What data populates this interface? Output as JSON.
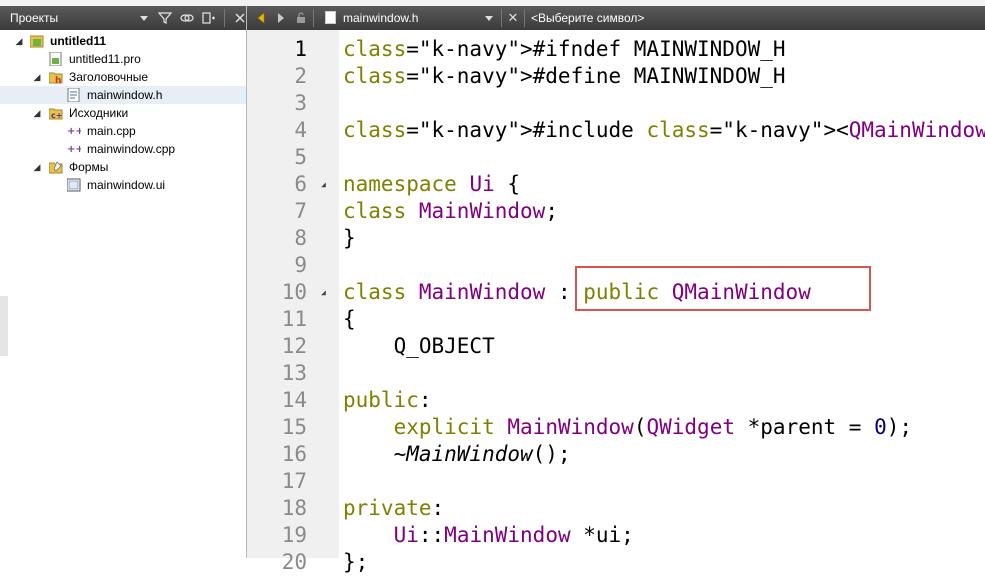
{
  "left_panel": {
    "selector_label": "Проекты",
    "toolbar_icons": [
      "filter-icon",
      "link-icon",
      "split-icon",
      "close-icon"
    ],
    "tree": [
      {
        "label": "untitled11",
        "level": 0,
        "expanded": true,
        "icon": "qt-project-icon",
        "bold": true
      },
      {
        "label": "untitled11.pro",
        "level": 1,
        "icon": "pro-file-icon"
      },
      {
        "label": "Заголовочные",
        "level": 1,
        "expanded": true,
        "icon": "header-folder-icon"
      },
      {
        "label": "mainwindow.h",
        "level": 2,
        "icon": "header-file-icon",
        "selected": true
      },
      {
        "label": "Исходники",
        "level": 1,
        "expanded": true,
        "icon": "source-folder-icon"
      },
      {
        "label": "main.cpp",
        "level": 2,
        "icon": "cpp-file-icon"
      },
      {
        "label": "mainwindow.cpp",
        "level": 2,
        "icon": "cpp-file-icon"
      },
      {
        "label": "Формы",
        "level": 1,
        "expanded": true,
        "icon": "forms-folder-icon"
      },
      {
        "label": "mainwindow.ui",
        "level": 2,
        "icon": "ui-file-icon"
      }
    ]
  },
  "editor": {
    "file_selector": "mainwindow.h",
    "symbol_selector": "<Выберите символ>",
    "lines": [
      {
        "num": "1",
        "text": "#ifndef MAINWINDOW_H"
      },
      {
        "num": "2",
        "text": "#define MAINWINDOW_H"
      },
      {
        "num": "3",
        "text": ""
      },
      {
        "num": "4",
        "text": "#include <QMainWindow>"
      },
      {
        "num": "5",
        "text": ""
      },
      {
        "num": "6",
        "text": "namespace Ui {",
        "fold": true
      },
      {
        "num": "7",
        "text": "class MainWindow;"
      },
      {
        "num": "8",
        "text": "}"
      },
      {
        "num": "9",
        "text": ""
      },
      {
        "num": "10",
        "text": "class MainWindow : public QMainWindow",
        "fold": true
      },
      {
        "num": "11",
        "text": "{"
      },
      {
        "num": "12",
        "text": "    Q_OBJECT"
      },
      {
        "num": "13",
        "text": ""
      },
      {
        "num": "14",
        "text": "public:"
      },
      {
        "num": "15",
        "text": "    explicit MainWindow(QWidget *parent = 0);"
      },
      {
        "num": "16",
        "text": "    ~MainWindow();"
      },
      {
        "num": "17",
        "text": ""
      },
      {
        "num": "18",
        "text": "private:"
      },
      {
        "num": "19",
        "text": "    Ui::MainWindow *ui;"
      },
      {
        "num": "20",
        "text": "};"
      }
    ],
    "highlight_text": ": public QMainWindow",
    "highlight_color": "#d9534f"
  }
}
